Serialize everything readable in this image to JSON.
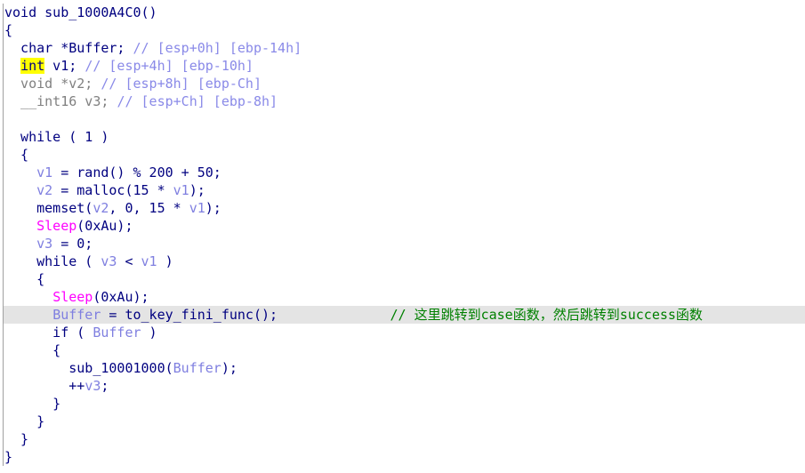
{
  "colors": {
    "code": "#000080",
    "variable": "#7f7fe0",
    "comment": "#8a8ae8",
    "import": "#ff00ff",
    "user_comment": "#008000",
    "highlight_line": "#e4e4e4",
    "highlight_word": "#ffff00"
  },
  "highlighted_line": 17,
  "lines": [
    [
      [
        "void sub_1000A4C0()",
        "code"
      ]
    ],
    [
      [
        "{",
        "code"
      ]
    ],
    [
      [
        "  char *Buffer; ",
        "code"
      ],
      [
        "// [esp+0h] [ebp-14h]",
        "cmt"
      ]
    ],
    [
      [
        "  ",
        "code"
      ],
      [
        "int",
        "kw-hl"
      ],
      [
        " v1; ",
        "code"
      ],
      [
        "// [esp+4h] [ebp-10h]",
        "cmt"
      ]
    ],
    [
      [
        "  void *v2; ",
        "gray"
      ],
      [
        "// [esp+8h] [ebp-Ch]",
        "cmt"
      ]
    ],
    [
      [
        "  __int16 v3; ",
        "gray"
      ],
      [
        "// [esp+Ch] [ebp-8h]",
        "cmt"
      ]
    ],
    [
      [
        "",
        "code"
      ]
    ],
    [
      [
        "  while ( 1 )",
        "code"
      ]
    ],
    [
      [
        "  {",
        "code"
      ]
    ],
    [
      [
        "    ",
        "code"
      ],
      [
        "v1",
        "var"
      ],
      [
        " = rand() % 200 + 50;",
        "code"
      ]
    ],
    [
      [
        "    ",
        "code"
      ],
      [
        "v2",
        "var"
      ],
      [
        " = malloc(15 * ",
        "code"
      ],
      [
        "v1",
        "var"
      ],
      [
        ");",
        "code"
      ]
    ],
    [
      [
        "    memset(",
        "code"
      ],
      [
        "v2",
        "var"
      ],
      [
        ", 0, 15 * ",
        "code"
      ],
      [
        "v1",
        "var"
      ],
      [
        ");",
        "code"
      ]
    ],
    [
      [
        "    ",
        "code"
      ],
      [
        "Sleep",
        "imp"
      ],
      [
        "(0xAu);",
        "code"
      ]
    ],
    [
      [
        "    ",
        "code"
      ],
      [
        "v3",
        "var"
      ],
      [
        " = 0;",
        "code"
      ]
    ],
    [
      [
        "    while ( ",
        "code"
      ],
      [
        "v3",
        "var"
      ],
      [
        " < ",
        "code"
      ],
      [
        "v1",
        "var"
      ],
      [
        " )",
        "code"
      ]
    ],
    [
      [
        "    {",
        "code"
      ]
    ],
    [
      [
        "      ",
        "code"
      ],
      [
        "Sleep",
        "imp"
      ],
      [
        "(0xAu);",
        "code"
      ]
    ],
    [
      [
        "      ",
        "code"
      ],
      [
        "Buffer",
        "var"
      ],
      [
        " = to_key_fini_func();              ",
        "code"
      ],
      [
        "// 这里跳转到case函数，然后跳转到success函数",
        "green"
      ]
    ],
    [
      [
        "      if ( ",
        "code"
      ],
      [
        "Buffer",
        "var"
      ],
      [
        " )",
        "code"
      ]
    ],
    [
      [
        "      {",
        "code"
      ]
    ],
    [
      [
        "        sub_10001000(",
        "code"
      ],
      [
        "Buffer",
        "var"
      ],
      [
        ");",
        "code"
      ]
    ],
    [
      [
        "        ++",
        "code"
      ],
      [
        "v3",
        "var"
      ],
      [
        ";",
        "code"
      ]
    ],
    [
      [
        "      }",
        "code"
      ]
    ],
    [
      [
        "    }",
        "code"
      ]
    ],
    [
      [
        "  }",
        "code"
      ]
    ],
    [
      [
        "}",
        "code"
      ]
    ]
  ]
}
